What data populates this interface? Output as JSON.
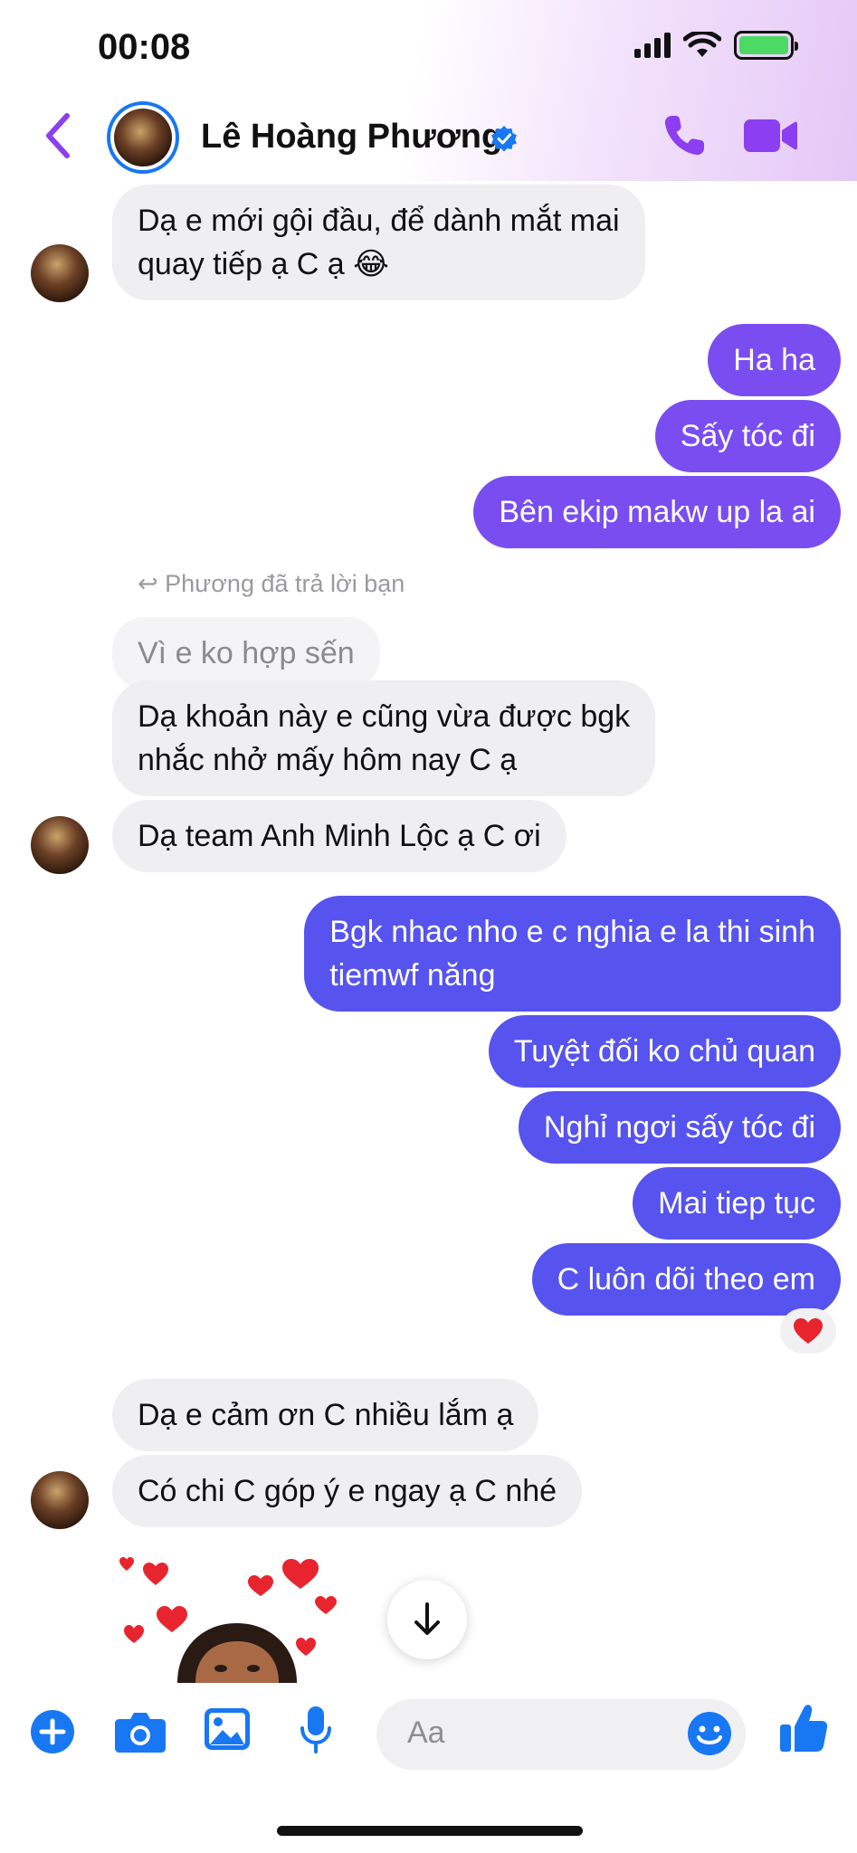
{
  "status_bar": {
    "time": "00:08"
  },
  "header": {
    "contact_name": "Lê Hoàng Phương"
  },
  "messages": [
    {
      "dir": "in",
      "text_lines": [
        "Dạ e mới gội đầu, để dành mắt mai",
        "quay tiếp ạ C ạ 😂"
      ]
    },
    {
      "dir": "out",
      "text": "Ha ha"
    },
    {
      "dir": "out",
      "text": "Sấy tóc đi"
    },
    {
      "dir": "out",
      "text": "Bên ekip makw up la ai"
    },
    {
      "reply_label": "Phương đã trả lời bạn",
      "quoted": "Vì e ko hợp sến"
    },
    {
      "dir": "in",
      "text_lines": [
        "Dạ khoản này e cũng vừa được bgk",
        "nhắc nhở mấy hôm nay C ạ"
      ]
    },
    {
      "dir": "in",
      "text": "Dạ team Anh Minh Lộc ạ C ơi"
    },
    {
      "dir": "out",
      "text_lines": [
        "Bgk nhac nho  e c nghia e la thi sinh",
        "tiemwf năng"
      ]
    },
    {
      "dir": "out",
      "text": "Tuyệt đối ko chủ quan"
    },
    {
      "dir": "out",
      "text": "Nghỉ ngơi sấy tóc đi"
    },
    {
      "dir": "out",
      "text": "Mai tiep tục"
    },
    {
      "dir": "out",
      "text": "C luôn dõi theo em",
      "reaction": "❤️"
    },
    {
      "dir": "in",
      "text": "Dạ e cảm ơn C nhiều lắm ạ"
    },
    {
      "dir": "in",
      "text": "Có chi C góp ý e ngay ạ C nhé"
    }
  ],
  "composer": {
    "placeholder": "Aa",
    "icons": [
      "plus-icon",
      "camera-icon",
      "image-icon",
      "microphone-icon",
      "emoji-icon",
      "like-icon"
    ]
  },
  "colors": {
    "accent_purple": "#8b3ff0",
    "bubble_violet": "#7a4df0",
    "bubble_blue": "#5653ee",
    "bubble_incoming": "#efeff2",
    "messenger_blue": "#1877f2"
  }
}
